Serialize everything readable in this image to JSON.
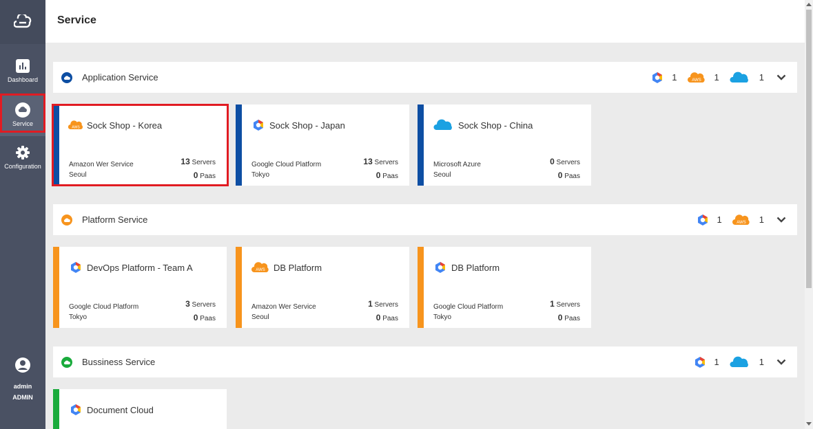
{
  "header": {
    "title": "Service"
  },
  "sidebar": {
    "items": [
      {
        "label": "Dashboard"
      },
      {
        "label": "Service"
      },
      {
        "label": "Configuration"
      }
    ],
    "user": {
      "name": "admin",
      "role": "ADMIN"
    }
  },
  "sections": [
    {
      "name": "Application Service",
      "color": "#0d4ea3",
      "counts": {
        "gcp": "1",
        "aws": "1",
        "azure": "1"
      },
      "cards": [
        {
          "title": "Sock Shop - Korea",
          "icon": "aws-icon",
          "provider": "Amazon Wer Service",
          "region": "Seoul",
          "servers": "13",
          "servers_label": "Servers",
          "paas": "0",
          "paas_label": "Paas"
        },
        {
          "title": "Sock Shop - Japan",
          "icon": "gcp-icon",
          "provider": "Google Cloud Platform",
          "region": "Tokyo",
          "servers": "13",
          "servers_label": "Servers",
          "paas": "0",
          "paas_label": "Paas"
        },
        {
          "title": "Sock Shop - China",
          "icon": "azure-icon",
          "provider": "Microsoft Azure",
          "region": "Seoul",
          "servers": "0",
          "servers_label": "Servers",
          "paas": "0",
          "paas_label": "Paas"
        }
      ]
    },
    {
      "name": "Platform Service",
      "color": "#f7941d",
      "counts": {
        "gcp": "1",
        "aws": "1"
      },
      "cards": [
        {
          "title": "DevOps Platform - Team A",
          "icon": "gcp-icon",
          "provider": "Google Cloud Platform",
          "region": "Tokyo",
          "servers": "3",
          "servers_label": "Servers",
          "paas": "0",
          "paas_label": "Paas"
        },
        {
          "title": "DB Platform",
          "icon": "aws-icon",
          "provider": "Amazon Wer Service",
          "region": "Seoul",
          "servers": "1",
          "servers_label": "Servers",
          "paas": "0",
          "paas_label": "Paas"
        },
        {
          "title": "DB Platform",
          "icon": "gcp-icon",
          "provider": "Google Cloud Platform",
          "region": "Tokyo",
          "servers": "1",
          "servers_label": "Servers",
          "paas": "0",
          "paas_label": "Paas"
        }
      ]
    },
    {
      "name": "Bussiness Service",
      "color": "#1aab3c",
      "counts": {
        "gcp": "1",
        "azure": "1"
      },
      "cards": [
        {
          "title": "Document Cloud",
          "icon": "gcp-icon"
        }
      ]
    }
  ],
  "aws_badge": "AWS"
}
